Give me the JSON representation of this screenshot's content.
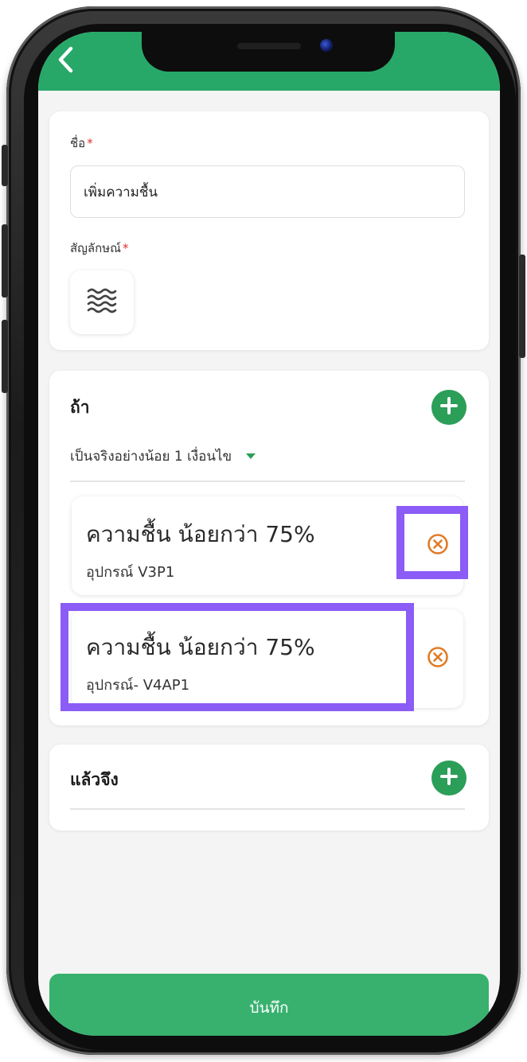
{
  "header": {
    "back_icon": "chevron-left-icon"
  },
  "name_section": {
    "name_label": "ชื่อ",
    "required_mark": "*",
    "name_value": "เพิ่มความชื้น",
    "symbol_label": "สัญลักษณ์",
    "symbol_icon": "water-waves-icon"
  },
  "if_section": {
    "title": "ถ้า",
    "condition_mode": "เป็นจริงอย่างน้อย 1 เงื่อนไข",
    "conditions": [
      {
        "title": "ความชื้น น้อยกว่า 75%",
        "device": "อุปกรณ์ V3P1"
      },
      {
        "title": "ความชื้น น้อยกว่า 75%",
        "device": "อุปกรณ์- V4AP1"
      }
    ]
  },
  "then_section": {
    "title": "แล้วจึง"
  },
  "footer": {
    "save_label": "บันทึก"
  },
  "colors": {
    "header_green": "#27a869",
    "add_button_green": "#2b9e58",
    "save_button_green": "#38b16f",
    "remove_icon_orange": "#e07b26",
    "highlight_purple": "#8b5cf6",
    "required_red": "#e03131"
  }
}
